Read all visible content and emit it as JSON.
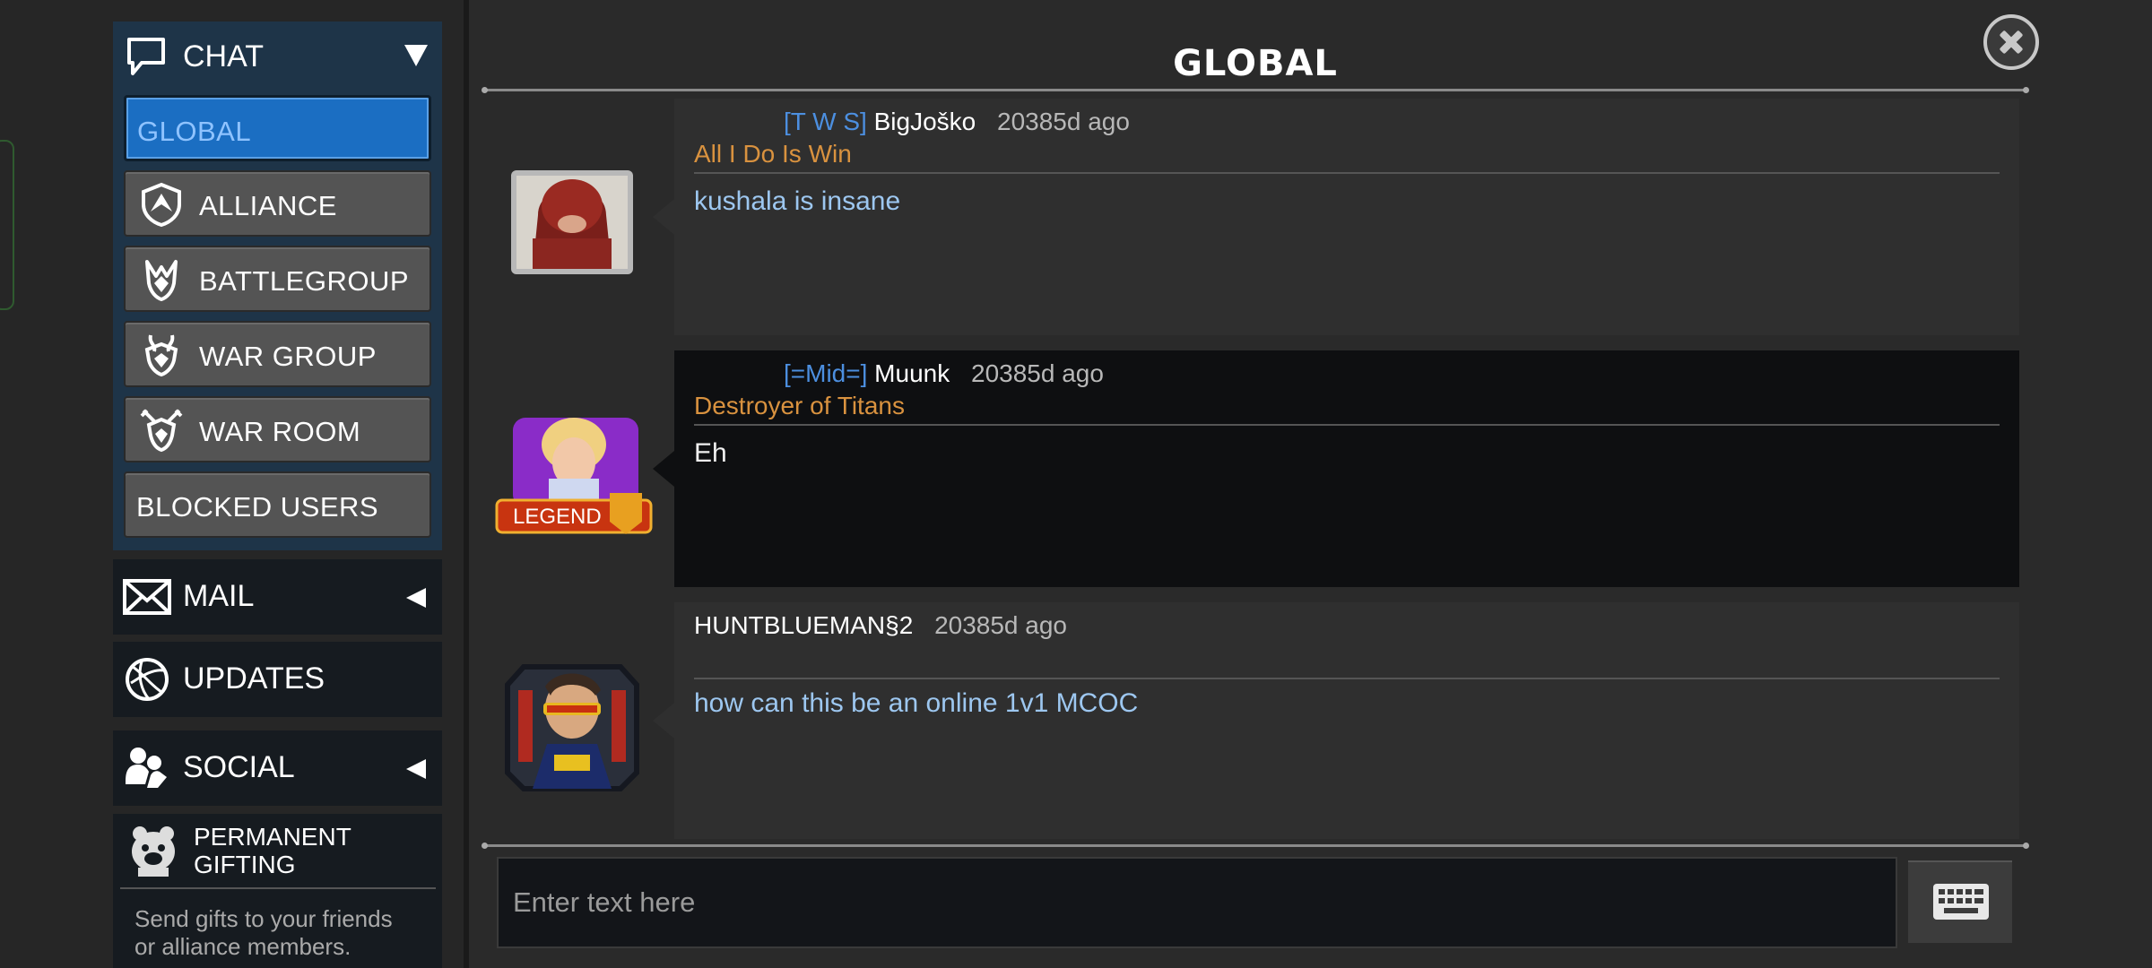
{
  "sidebar": {
    "chat_label": "CHAT",
    "channels": [
      {
        "label": "GLOBAL",
        "active": true
      },
      {
        "label": "ALLIANCE",
        "icon": "alliance-shield-icon"
      },
      {
        "label": "BATTLEGROUP",
        "icon": "battlegroup-icon"
      },
      {
        "label": "WAR GROUP",
        "icon": "war-group-icon"
      },
      {
        "label": "WAR ROOM",
        "icon": "war-room-icon"
      },
      {
        "label": "BLOCKED USERS"
      }
    ],
    "mail_label": "MAIL",
    "updates_label": "UPDATES",
    "social_label": "SOCIAL",
    "gifting_title_line1": "PERMANENT",
    "gifting_title_line2": "GIFTING",
    "gifting_desc_line1": "Send gifts to your friends",
    "gifting_desc_line2": "or alliance members."
  },
  "main": {
    "title": "GLOBAL",
    "messages": [
      {
        "tag": "[T W S]",
        "name": "BigJoško",
        "time": "20385d ago",
        "subtitle": "All I Do Is Win",
        "text": "kushala is insane",
        "avatar": "juggernaut-avatar"
      },
      {
        "tag": "[=Mid=]",
        "name": "Muunk",
        "time": "20385d ago",
        "subtitle": "Destroyer of Titans",
        "text": "Eh",
        "avatar": "dazzler-legend-avatar",
        "badge": "LEGEND"
      },
      {
        "tag": "",
        "name": "HUNTBLUEMAN§2",
        "time": "20385d ago",
        "subtitle": "",
        "text": "how can this be an online 1v1 MCOC",
        "avatar": "cyclops-avatar"
      }
    ],
    "input_placeholder": "Enter text here"
  },
  "colors": {
    "active_channel": "#1b6ec2",
    "alliance_tag": "#4c8fe0",
    "subtitle": "#d9923f",
    "message_text": "#9dc7f0"
  }
}
